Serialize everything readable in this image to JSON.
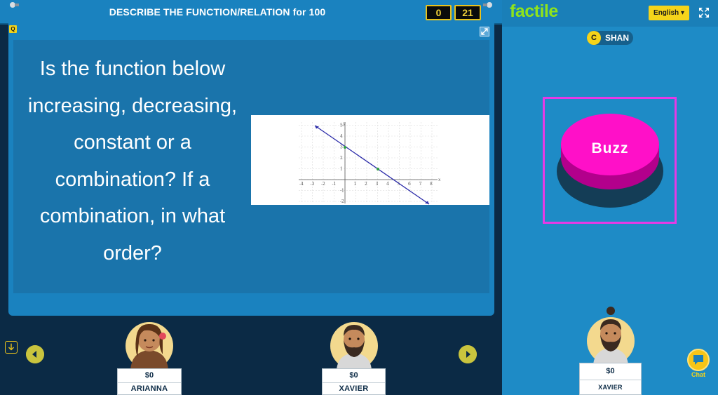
{
  "topbar": {
    "title": "DESCRIBE THE FUNCTION/RELATION for 100",
    "score_left": "0",
    "score_right": "21"
  },
  "board": {
    "badge": "Q",
    "question": "Is the function below increasing, decreasing, constant or a combination? If a combination, in what order?",
    "graph": {
      "x_ticks": [
        "-4",
        "-3",
        "-2",
        "-1",
        "1",
        "2",
        "3",
        "4",
        "5",
        "6",
        "7",
        "8"
      ],
      "y_ticks": [
        "5",
        "4",
        "3",
        "2",
        "1",
        "-1",
        "-2"
      ],
      "x_axis_label": "x",
      "y_axis_label": "y"
    }
  },
  "players": [
    {
      "money": "$0",
      "name": "ARIANNA"
    },
    {
      "money": "$0",
      "name": "XAVIER"
    }
  ],
  "side": {
    "logo": "factile",
    "language": "English",
    "team_letter": "C",
    "team_name": "SHAN",
    "buzz_label": "Buzz",
    "me": {
      "money": "$0",
      "name": "XAVIER"
    },
    "chat_label": "Chat"
  },
  "colors": {
    "accent_yellow": "#f5d41a",
    "board_blue": "#1a82bf",
    "buzz_magenta": "#ff10c8",
    "logo_green": "#8fe31c"
  }
}
